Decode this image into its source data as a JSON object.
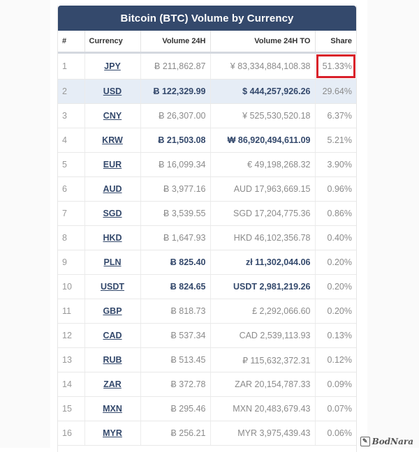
{
  "title": "Bitcoin (BTC) Volume by Currency",
  "columns": {
    "rank": "#",
    "currency": "Currency",
    "volume_24h": "Volume 24H",
    "volume_24h_to": "Volume 24H TO",
    "share": "Share"
  },
  "rows": [
    {
      "rank": "1",
      "currency": "JPY",
      "volume": "Ƀ 211,862.87",
      "volume_to": "¥ 83,334,884,108.38",
      "share": "51.33%",
      "emphasized": false,
      "highlighted": false,
      "boxed": true
    },
    {
      "rank": "2",
      "currency": "USD",
      "volume": "Ƀ 122,329.99",
      "volume_to": "$ 444,257,926.26",
      "share": "29.64%",
      "emphasized": true,
      "highlighted": true,
      "boxed": false
    },
    {
      "rank": "3",
      "currency": "CNY",
      "volume": "Ƀ 26,307.00",
      "volume_to": "¥ 525,530,520.18",
      "share": "6.37%",
      "emphasized": false,
      "highlighted": false,
      "boxed": false
    },
    {
      "rank": "4",
      "currency": "KRW",
      "volume": "Ƀ 21,503.08",
      "volume_to": "₩ 86,920,494,611.09",
      "share": "5.21%",
      "emphasized": true,
      "highlighted": false,
      "boxed": false
    },
    {
      "rank": "5",
      "currency": "EUR",
      "volume": "Ƀ 16,099.34",
      "volume_to": "€ 49,198,268.32",
      "share": "3.90%",
      "emphasized": false,
      "highlighted": false,
      "boxed": false
    },
    {
      "rank": "6",
      "currency": "AUD",
      "volume": "Ƀ 3,977.16",
      "volume_to": "AUD 17,963,669.15",
      "share": "0.96%",
      "emphasized": false,
      "highlighted": false,
      "boxed": false
    },
    {
      "rank": "7",
      "currency": "SGD",
      "volume": "Ƀ 3,539.55",
      "volume_to": "SGD 17,204,775.36",
      "share": "0.86%",
      "emphasized": false,
      "highlighted": false,
      "boxed": false
    },
    {
      "rank": "8",
      "currency": "HKD",
      "volume": "Ƀ 1,647.93",
      "volume_to": "HKD 46,102,356.78",
      "share": "0.40%",
      "emphasized": false,
      "highlighted": false,
      "boxed": false
    },
    {
      "rank": "9",
      "currency": "PLN",
      "volume": "Ƀ 825.40",
      "volume_to": "zł 11,302,044.06",
      "share": "0.20%",
      "emphasized": true,
      "highlighted": false,
      "boxed": false
    },
    {
      "rank": "10",
      "currency": "USDT",
      "volume": "Ƀ 824.65",
      "volume_to": "USDT 2,981,219.26",
      "share": "0.20%",
      "emphasized": true,
      "highlighted": false,
      "boxed": false
    },
    {
      "rank": "11",
      "currency": "GBP",
      "volume": "Ƀ 818.73",
      "volume_to": "£ 2,292,066.60",
      "share": "0.20%",
      "emphasized": false,
      "highlighted": false,
      "boxed": false
    },
    {
      "rank": "12",
      "currency": "CAD",
      "volume": "Ƀ 537.34",
      "volume_to": "CAD 2,539,113.93",
      "share": "0.13%",
      "emphasized": false,
      "highlighted": false,
      "boxed": false
    },
    {
      "rank": "13",
      "currency": "RUB",
      "volume": "Ƀ 513.45",
      "volume_to": "₽ 115,632,372.31",
      "share": "0.12%",
      "emphasized": false,
      "highlighted": false,
      "boxed": false
    },
    {
      "rank": "14",
      "currency": "ZAR",
      "volume": "Ƀ 372.78",
      "volume_to": "ZAR 20,154,787.33",
      "share": "0.09%",
      "emphasized": false,
      "highlighted": false,
      "boxed": false
    },
    {
      "rank": "15",
      "currency": "MXN",
      "volume": "Ƀ 295.46",
      "volume_to": "MXN 20,483,679.43",
      "share": "0.07%",
      "emphasized": false,
      "highlighted": false,
      "boxed": false
    },
    {
      "rank": "16",
      "currency": "MYR",
      "volume": "Ƀ 256.21",
      "volume_to": "MYR 3,975,439.43",
      "share": "0.06%",
      "emphasized": false,
      "highlighted": false,
      "boxed": false
    }
  ],
  "colors": {
    "header_bg": "#34496c",
    "highlight_row": "#e6edf6",
    "annotation_box": "#d9202a",
    "link": "#34496c"
  },
  "watermark": {
    "text": "BodNara",
    "icon": "watermark-badge-icon"
  }
}
